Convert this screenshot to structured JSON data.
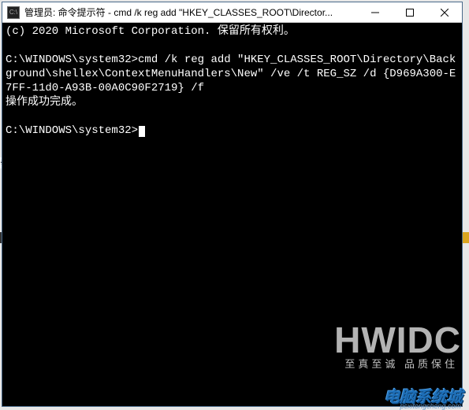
{
  "window": {
    "title": "管理员: 命令提示符 - cmd  /k reg add \"HKEY_CLASSES_ROOT\\Director..."
  },
  "terminal": {
    "line1": "(c) 2020 Microsoft Corporation. 保留所有权利。",
    "blank1": "",
    "line2": "C:\\WINDOWS\\system32>cmd /k reg add \"HKEY_CLASSES_ROOT\\Directory\\Background\\shellex\\ContextMenuHandlers\\New\" /ve /t REG_SZ /d {D969A300-E7FF-11d0-A93B-00A0C90F2719} /f",
    "line3": "操作成功完成。",
    "blank2": "",
    "prompt": "C:\\WINDOWS\\system32>"
  },
  "watermark": {
    "big": "HWIDC",
    "sub": "至真至诚 品质保住",
    "logo": "电脑系统城",
    "logo_sub": "pcxitongcheng.com"
  }
}
